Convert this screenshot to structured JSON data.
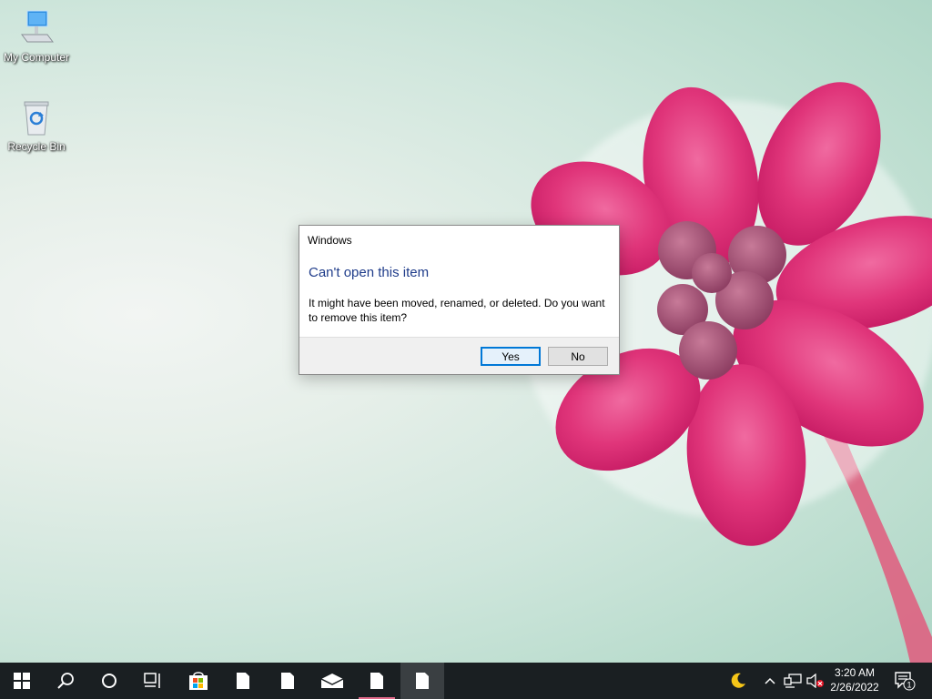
{
  "desktop": {
    "icons": [
      {
        "label": "My Computer",
        "icon": "computer-icon"
      },
      {
        "label": "Recycle Bin",
        "icon": "recycle-bin-icon"
      }
    ]
  },
  "dialog": {
    "title": "Windows",
    "heading": "Can't open this item",
    "message": "It might have been moved, renamed, or deleted. Do you want to remove this item?",
    "yes_label": "Yes",
    "no_label": "No"
  },
  "taskbar": {
    "items": [
      {
        "icon": "windows-start-icon"
      },
      {
        "icon": "search-icon"
      },
      {
        "icon": "cortana-icon"
      },
      {
        "icon": "task-view-icon"
      },
      {
        "icon": "store-icon"
      },
      {
        "icon": "document-icon"
      },
      {
        "icon": "document-icon"
      },
      {
        "icon": "mail-icon"
      },
      {
        "icon": "document-icon"
      },
      {
        "icon": "document-icon"
      }
    ],
    "tray": {
      "icons": [
        "night-light-icon",
        "chevron-up-icon",
        "network-icon",
        "volume-muted-icon"
      ],
      "time": "3:20 AM",
      "date": "2/26/2022",
      "notification_count": "1"
    }
  },
  "colors": {
    "taskbar": "#1a1f22",
    "accent": "#0078d7",
    "heading": "#1f3c8a",
    "flower": "#e0357a"
  }
}
